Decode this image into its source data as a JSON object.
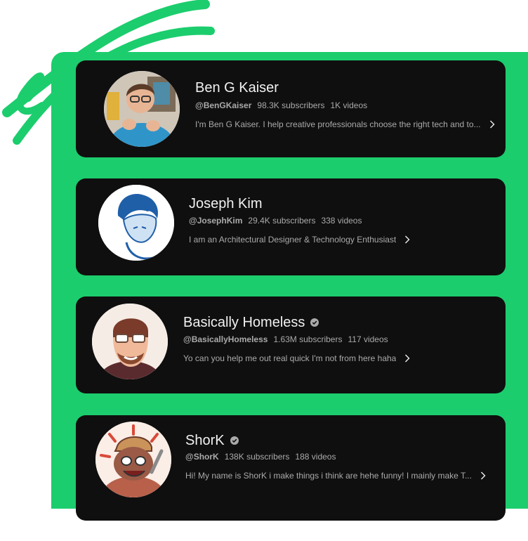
{
  "colors": {
    "accent": "#1ccd6d",
    "card_bg": "#0f0f0f",
    "text_primary": "#f1f1f1",
    "text_secondary": "#aaaaaa"
  },
  "channels": [
    {
      "name": "Ben G Kaiser",
      "verified": false,
      "handle": "@BenGKaiser",
      "subscribers": "98.3K subscribers",
      "videos": "1K videos",
      "description": "I'm Ben G Kaiser. I help creative professionals choose the right tech and to...",
      "chevron_icon": "chevron-right-icon"
    },
    {
      "name": "Joseph Kim",
      "verified": false,
      "handle": "@JosephKim",
      "subscribers": "29.4K subscribers",
      "videos": "338 videos",
      "description": "I am an Architectural Designer & Technology Enthusiast",
      "chevron_icon": "chevron-right-icon"
    },
    {
      "name": "Basically Homeless",
      "verified": true,
      "handle": "@BasicallyHomeless",
      "subscribers": "1.63M subscribers",
      "videos": "117 videos",
      "description": "Yo can you help me out real quick I'm not from here haha",
      "chevron_icon": "chevron-right-icon"
    },
    {
      "name": "ShorK",
      "verified": true,
      "handle": "@ShorK",
      "subscribers": "138K subscribers",
      "videos": "188 videos",
      "description": "Hi! My name is ShorK i make things i think are hehe funny! I mainly make T...",
      "chevron_icon": "chevron-right-icon"
    }
  ]
}
